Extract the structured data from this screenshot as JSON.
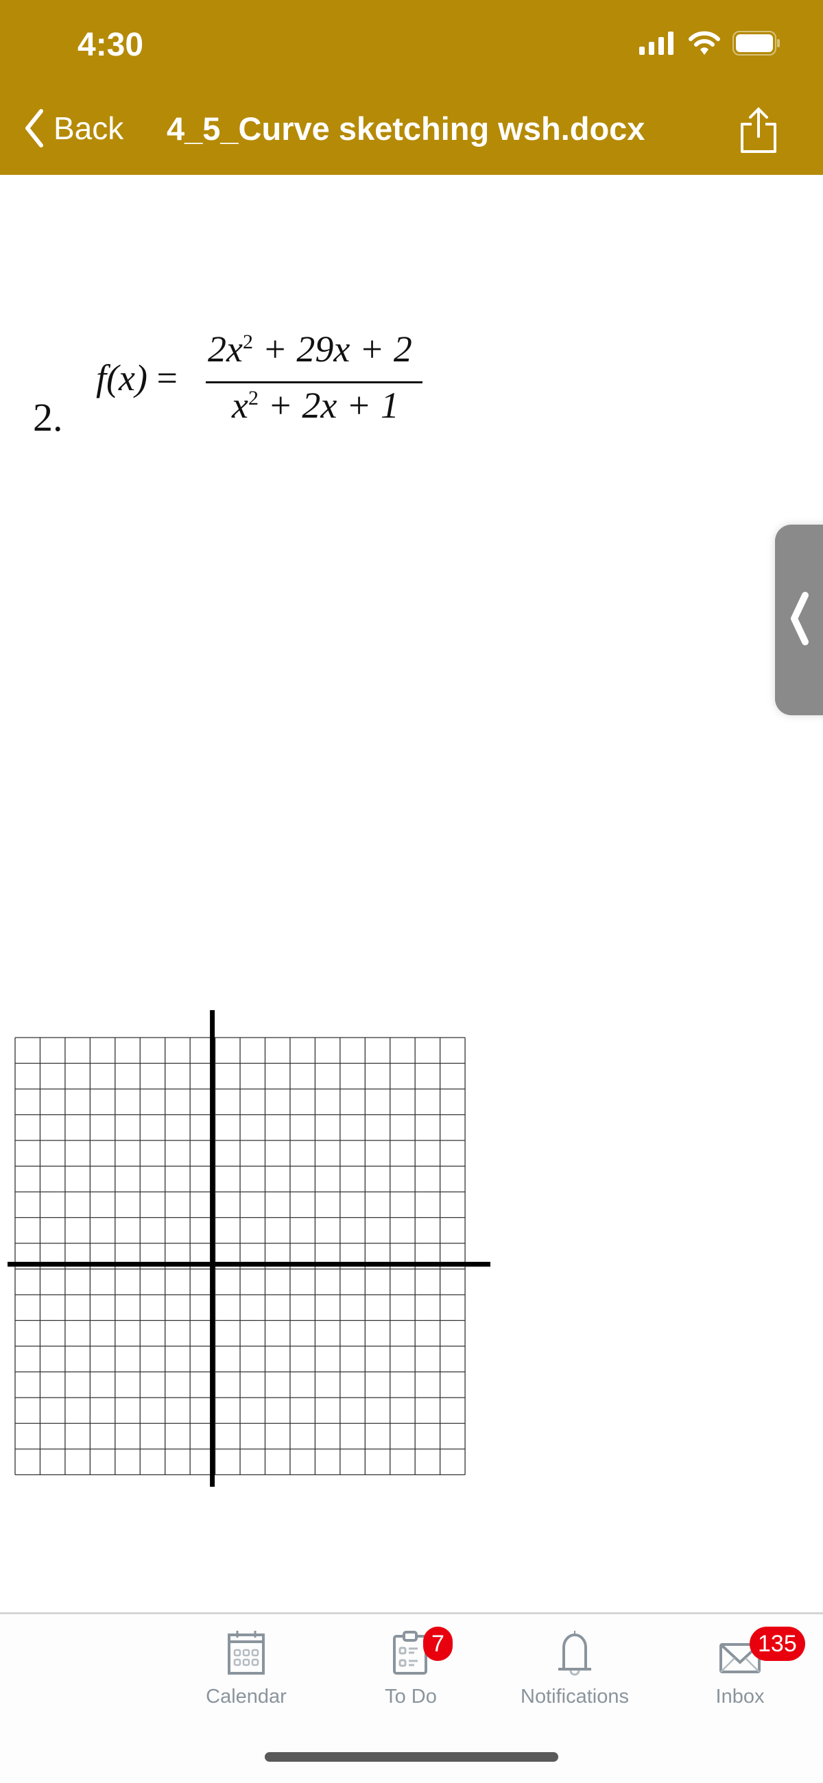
{
  "status_bar": {
    "time": "4:30"
  },
  "nav": {
    "back_label": "Back",
    "title": "4_5_Curve sketching wsh.docx"
  },
  "document": {
    "problem_number": "2.",
    "function_lhs": "f(x)",
    "equals": "=",
    "numerator": {
      "t1": "2x",
      "e1": "2",
      "rest": " + 29x + 2"
    },
    "denominator": {
      "t1": "x",
      "e1": "2",
      "rest": " + 2x + 1"
    }
  },
  "tabbar": {
    "items": [
      {
        "label": "Calendar",
        "icon": "calendar-icon"
      },
      {
        "label": "To Do",
        "icon": "todo-icon",
        "badge": "7"
      },
      {
        "label": "Notifications",
        "icon": "bell-icon"
      },
      {
        "label": "Inbox",
        "icon": "inbox-icon",
        "badge": "135"
      }
    ]
  },
  "colors": {
    "header": "#b58a07",
    "badge": "#e8000e",
    "tab_icon": "#8a949c"
  }
}
